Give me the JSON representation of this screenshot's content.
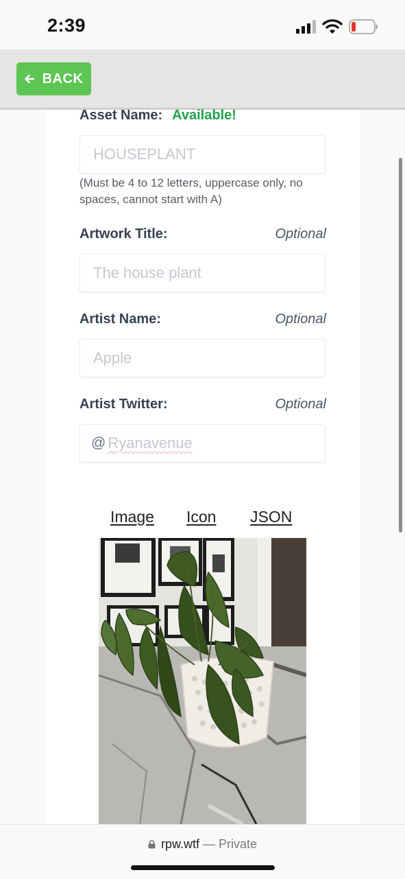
{
  "status_bar": {
    "time": "2:39",
    "icons": [
      "cellular-signal-icon",
      "wifi-icon",
      "battery-low-icon"
    ]
  },
  "header": {
    "back_label": "BACK"
  },
  "form": {
    "asset_name": {
      "label": "Asset Name:",
      "status": "Available!",
      "value": "HOUSEPLANT",
      "hint": "(Must be 4 to 12 letters, uppercase only, no spaces, cannot start with A)"
    },
    "artwork_title": {
      "label": "Artwork Title:",
      "optional": "Optional",
      "value": "The house plant"
    },
    "artist_name": {
      "label": "Artist Name:",
      "optional": "Optional",
      "value": "Apple"
    },
    "artist_twitter": {
      "label": "Artist Twitter:",
      "optional": "Optional",
      "prefix": "@",
      "value": "Ryanavenue"
    }
  },
  "links": {
    "image": "Image",
    "icon": "Icon",
    "json": "JSON"
  },
  "browser": {
    "domain": "rpw.wtf",
    "mode": "— Private"
  },
  "colors": {
    "back_button": "#5cc553",
    "available_text": "#22a04b"
  }
}
